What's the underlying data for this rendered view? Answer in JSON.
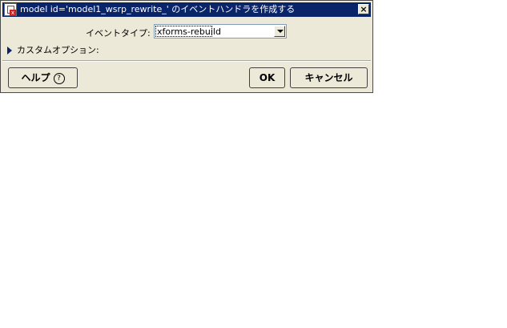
{
  "window": {
    "title": "model id='model1_wsrp_rewrite_' のイベントハンドラを作成する",
    "close_glyph": "×"
  },
  "form": {
    "event_type_label": "イベントタイプ:",
    "event_type_value": "xforms-rebuild"
  },
  "custom_options": {
    "label": "カスタムオプション:"
  },
  "buttons": {
    "help_label": "ヘルプ",
    "help_icon_glyph": "?",
    "ok_label": "OK",
    "cancel_label": "キャンセル"
  },
  "colors": {
    "titlebar": "#0a246a",
    "dialog_bg": "#ece9d8",
    "input_border": "#7f9db9"
  }
}
